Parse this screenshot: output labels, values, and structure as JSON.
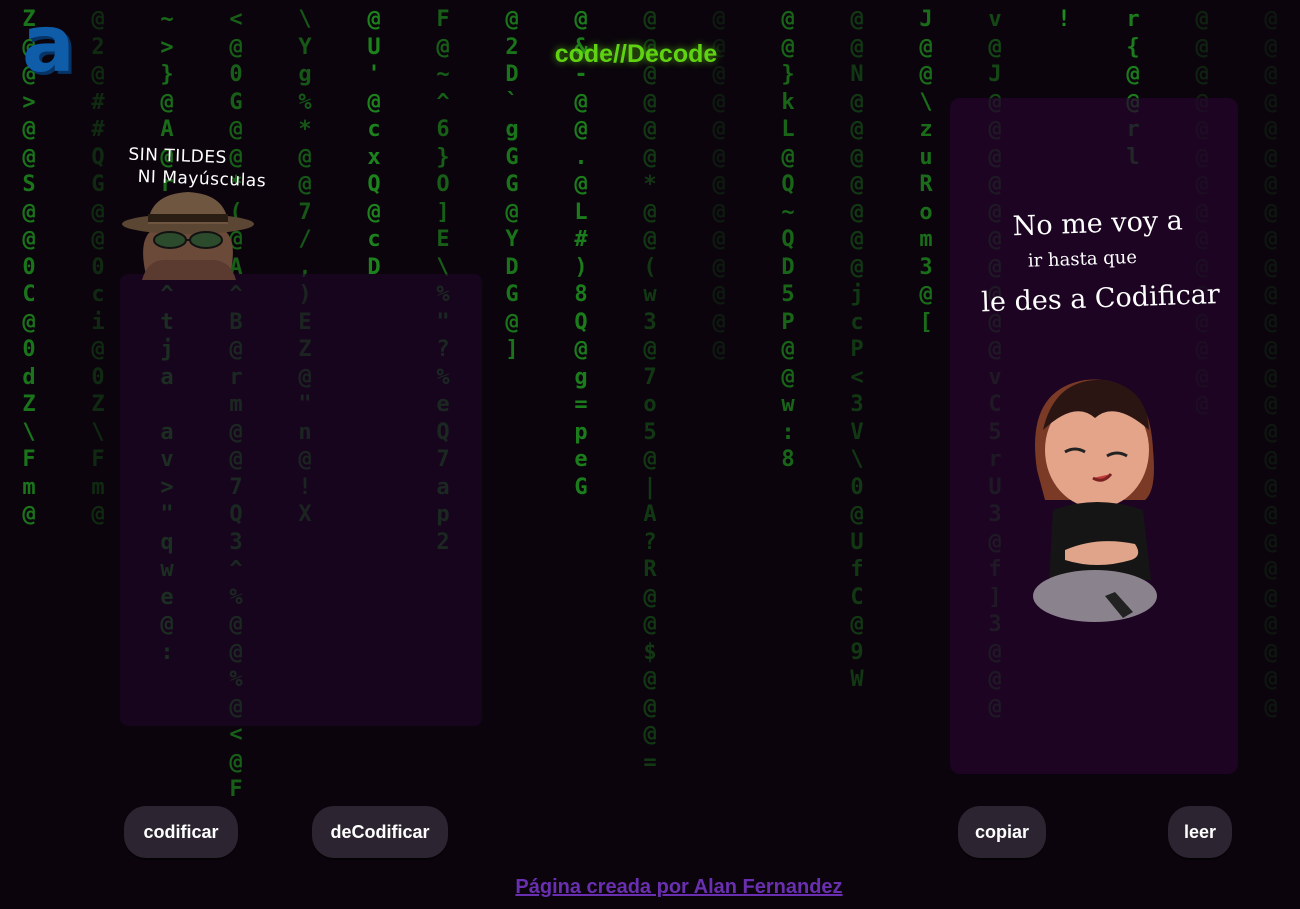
{
  "app": {
    "logo_letter": "a",
    "title": "code//Decode"
  },
  "hint": {
    "line1": "SIN TILDES",
    "line2": "NI Mayúsculas"
  },
  "input": {
    "value": "",
    "placeholder": ""
  },
  "output": {
    "value": "",
    "message_line1": "No me voy a",
    "message_line2": "ir hasta que",
    "message_line3": "le des a Codificar"
  },
  "buttons": {
    "encode": "codificar",
    "decode": "deCodificar",
    "copy": "copiar",
    "read": "leer"
  },
  "footer": {
    "credit": "Página creada por Alan Fernandez"
  },
  "colors": {
    "background": "#0b040d",
    "rain_green": "#1f9a1f",
    "title_green": "#5fd212",
    "logo_blue": "#0f5ca8",
    "button_bg": "#2c2430",
    "footer_purple": "#6a2fb0"
  },
  "background_rain": [
    "Z@@>@@S@@0C@0dZ\\Fm@",
    "@2@##QG@@0ci@0Z\\Fm@",
    "~>}@A@rQGI^tja av>\"qwe@:",
    "<@0G@@*(@A^B@rm@@7Q3^%@@%@<@F",
    "\\Yg%*@@7/,)EZ@\"n@!X",
    "@U'@cxQ@cD",
    "F@~^6}O]E\\%\"?%eQ7ap2",
    "@2D`gGG@YDG@]",
    "@&-@@.@L#)8Q@g=peG",
    "@@@@@@*@@(w3@7o5@|A?R@@$@@@=",
    "@@@@@@@@@@@@@",
    "@@}kL@Q~QD5P@@w:8",
    "@@N@@@@@@@jcP<3V\\0@UfC@9W",
    "J@@\\zuRom3@[",
    "v@J@@@@@@@@@@vC5rU3@f]3@@@",
    "!",
    "r{@@rl",
    "@@@@@@@@@@@@@@@",
    "@@@@@@@@@@@@@@@@@@@@@@@@@@"
  ]
}
